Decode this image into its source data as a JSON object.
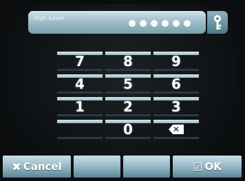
{
  "password": {
    "label": "High Level",
    "masked_length": 6
  },
  "keypad": {
    "keys": [
      "7",
      "8",
      "9",
      "4",
      "5",
      "6",
      "1",
      "2",
      "3",
      "",
      "0",
      "delete"
    ]
  },
  "buttons": {
    "cancel": "Cancel",
    "ok": "OK"
  },
  "colors": {
    "accent": "#9fbfca",
    "background": "#0b0d0e",
    "text": "#ffffff"
  }
}
